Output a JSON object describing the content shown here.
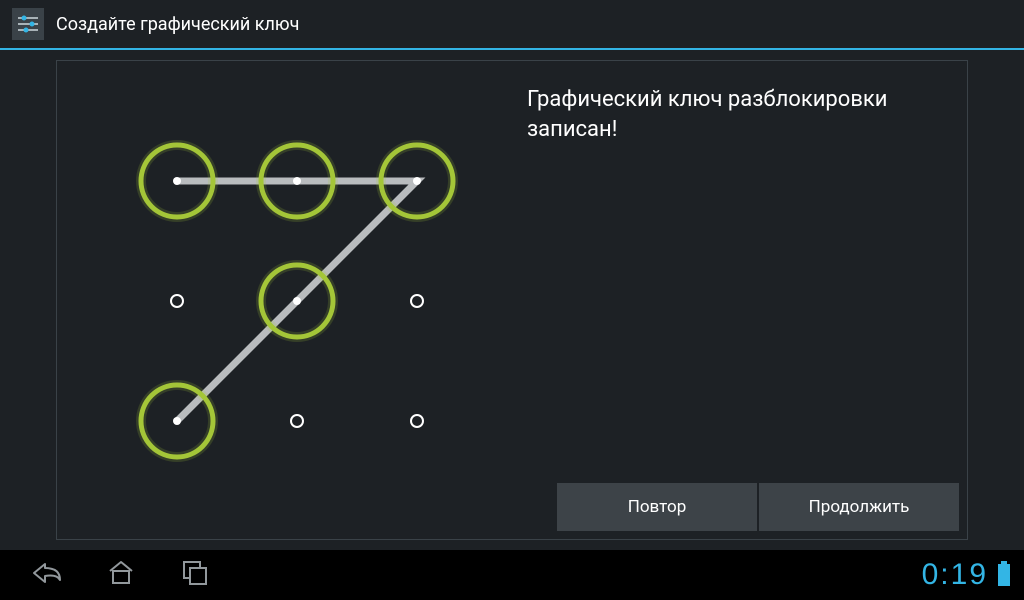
{
  "titlebar": {
    "title": "Создайте графический ключ"
  },
  "message": "Графический ключ разблокировки записан!",
  "pattern": {
    "selected_cells": [
      0,
      1,
      2,
      4,
      6
    ],
    "path_sequence": [
      0,
      1,
      2,
      4,
      6
    ]
  },
  "buttons": {
    "retry": "Повтор",
    "continue": "Продолжить"
  },
  "statusbar": {
    "time": "0:19"
  },
  "colors": {
    "accent": "#33b5e5",
    "ring": "#a4c639",
    "bg": "#1d2125"
  }
}
